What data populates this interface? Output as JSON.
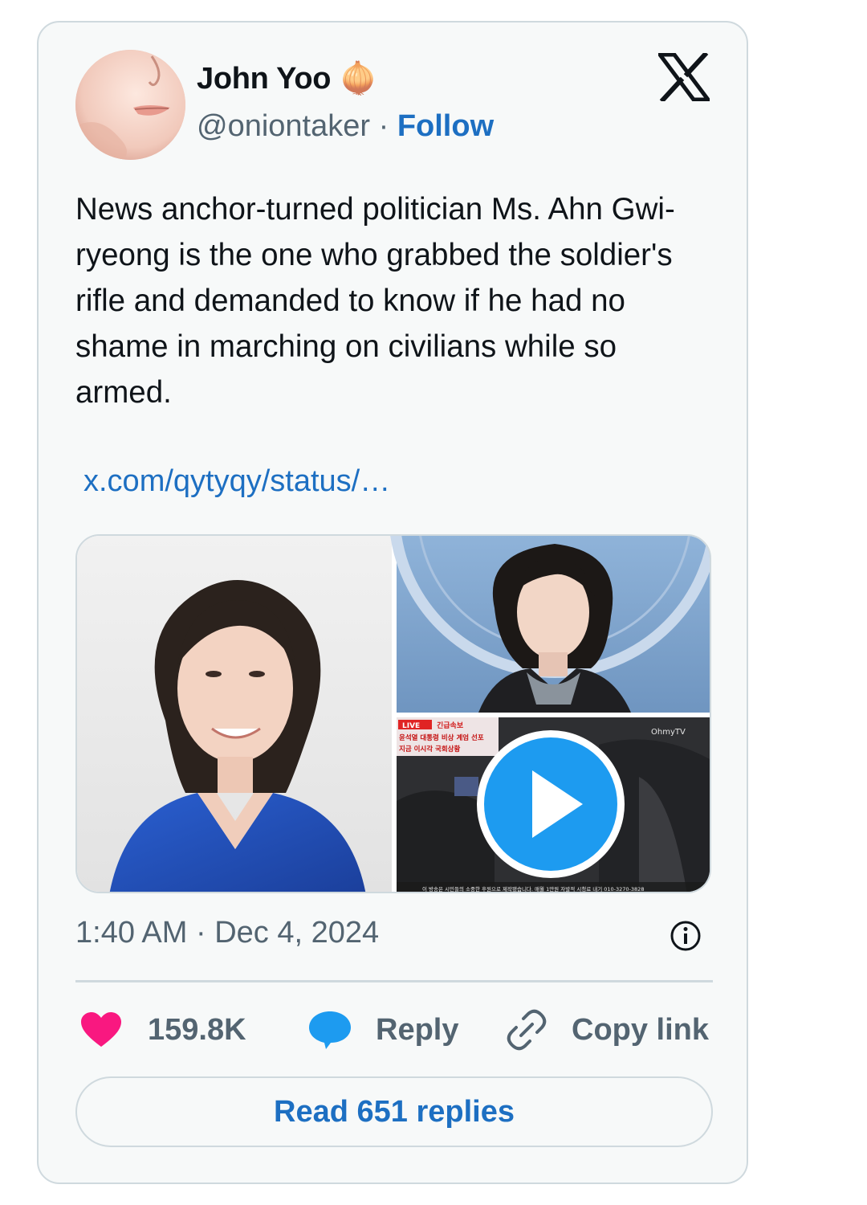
{
  "author": {
    "name": "John Yoo 🧅",
    "handle": "@oniontaker",
    "separator": "·",
    "follow_label": "Follow"
  },
  "tweet": {
    "text": "News anchor-turned politician Ms. Ahn Gwi-ryeong is the one who grabbed the soldier's rifle and demanded to know if he had no shame in marching on civilians while so armed.",
    "link": "x.com/qytyqy/status/…",
    "timestamp": "1:40 AM · Dec 4, 2024"
  },
  "media": {
    "live_badge": "LIVE",
    "breaking_label": "긴급속보",
    "headline_1": "윤석열 대통령 비상 계엄 선포",
    "headline_2": "지금 이시각 국회상황",
    "channel_watermark": "OhmyTV",
    "bottom_ticker": "이 방송은 시민들의 소중한 후원으로 제작됐습니다. 매월 1만원 자발적 시청료 내기 010-3270-3828"
  },
  "actions": {
    "likes": "159.8K",
    "reply_label": "Reply",
    "copy_label": "Copy link"
  },
  "read_replies": "Read 651 replies",
  "colors": {
    "accent": "#1d6fc2",
    "like": "#f91880",
    "reply_icon": "#1d9bf0",
    "secondary_text": "#536471",
    "border": "#cfd9de"
  },
  "icons": [
    "x-logo-icon",
    "info-icon",
    "heart-icon",
    "reply-bubble-icon",
    "link-icon",
    "play-icon"
  ]
}
